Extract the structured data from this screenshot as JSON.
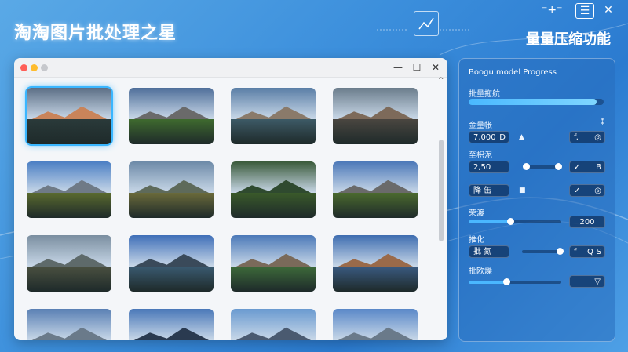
{
  "header": {
    "app_title": "淘淘图片批处理之星",
    "right_title": "量量压缩功能",
    "controls": [
      "⁻+⁻",
      "☰",
      "✕"
    ]
  },
  "window": {
    "dots": [
      "#ff5f57",
      "#febc2e",
      "#c6c8cc"
    ],
    "buttons": [
      "—",
      "☐",
      "✕"
    ],
    "scroll_up": "^"
  },
  "thumbnails": [
    {
      "sky": "#5c6f86",
      "mtn": "#c9845a",
      "ground": "#2a3a3a",
      "selected": true
    },
    {
      "sky": "#4f6f9a",
      "mtn": "#6a6a6a",
      "ground": "#3f6a2e"
    },
    {
      "sky": "#5a7ea6",
      "mtn": "#8a7a6a",
      "ground": "#3d5a66"
    },
    {
      "sky": "#6b7d8c",
      "mtn": "#7d6a5a",
      "ground": "#4a4640"
    },
    {
      "sky": "#4b7fc4",
      "mtn": "#6f7a86",
      "ground": "#5a6a2e"
    },
    {
      "sky": "#6d8aa8",
      "mtn": "#5e6a5a",
      "ground": "#6a6a3a"
    },
    {
      "sky": "#3a5a3a",
      "mtn": "#2f4a2f",
      "ground": "#3a5a2a"
    },
    {
      "sky": "#4c78b8",
      "mtn": "#6a6a6a",
      "ground": "#4b6a2e"
    },
    {
      "sky": "#7a8ea0",
      "mtn": "#5e6a6a",
      "ground": "#4a5040"
    },
    {
      "sky": "#3f6fb8",
      "mtn": "#3a4a5a",
      "ground": "#3a5a70"
    },
    {
      "sky": "#4b79b8",
      "mtn": "#7a6a5a",
      "ground": "#3d6a3a"
    },
    {
      "sky": "#3e6db0",
      "mtn": "#9a6a4a",
      "ground": "#3a5a80"
    },
    {
      "sky": "#5a80b4",
      "mtn": "#6a7a8a",
      "ground": "#6a7080"
    },
    {
      "sky": "#4a78b8",
      "mtn": "#2a3a50",
      "ground": "#3a4a60"
    },
    {
      "sky": "#6a9ad0",
      "mtn": "#4a5a70",
      "ground": "#2a3a4a"
    },
    {
      "sky": "#5a88c8",
      "mtn": "#6a7a8a",
      "ground": "#4a5a6a"
    }
  ],
  "panel": {
    "title": "Boogu model Progress",
    "progress_label": "批量拖航",
    "progress": 0.95,
    "quality_label": "金量帐",
    "quality_value": "7,000",
    "quality_unit": "D",
    "quality_mark": "▲",
    "quality_btn_a": "f.",
    "quality_btn_b": "◎",
    "quality_side": "⁑",
    "size_label": "至枳泥",
    "size_value": "2,50",
    "size_btn_a": "✓",
    "size_btn_b": "B",
    "mode_label": "降 缶",
    "mode_mark": "■",
    "mode_btn_a": "✓",
    "mode_btn_b": "◎",
    "level_label": "荣渡",
    "level_value": "200",
    "level_pct": 0.45,
    "batch_label": "推化",
    "batch_field": "批 氮",
    "batch_btn_a": "f",
    "batch_btn_b": "Q",
    "batch_btn_c": "S",
    "end_label": "批欧燥",
    "end_btn": "▽"
  }
}
